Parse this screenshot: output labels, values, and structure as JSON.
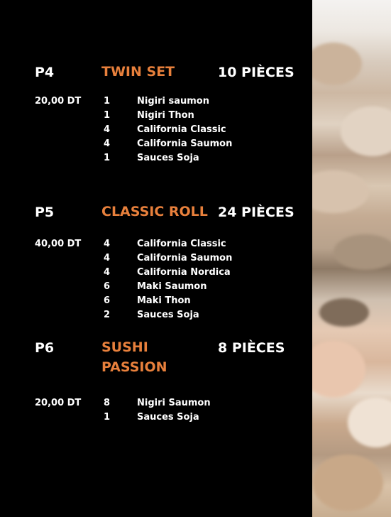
{
  "menu": {
    "sections": [
      {
        "code": "P4",
        "name_lines": [
          "TWIN SET"
        ],
        "pieces": "10 PIÈCES",
        "price": "20,00 DT",
        "items": [
          {
            "qty": "1",
            "name": "Nigiri saumon"
          },
          {
            "qty": "1",
            "name": "Nigiri Thon"
          },
          {
            "qty": "4",
            "name": "California Classic"
          },
          {
            "qty": "4",
            "name": "California Saumon"
          },
          {
            "qty": "1",
            "name": "Sauces Soja"
          }
        ]
      },
      {
        "code": "P5",
        "name_lines": [
          "CLASSIC ROLL"
        ],
        "pieces": "24 PIÈCES",
        "price": "40,00 DT",
        "items": [
          {
            "qty": "4",
            "name": "California Classic"
          },
          {
            "qty": "4",
            "name": "California Saumon"
          },
          {
            "qty": "4",
            "name": "California Nordica"
          },
          {
            "qty": "6",
            "name": "Maki Saumon"
          },
          {
            "qty": "6",
            "name": "Maki Thon"
          },
          {
            "qty": "2",
            "name": "Sauces Soja"
          }
        ]
      },
      {
        "code": "P6",
        "name_lines": [
          "SUSHI",
          "PASSION"
        ],
        "pieces": "8 PIÈCES",
        "price": "20,00 DT",
        "items": [
          {
            "qty": "8",
            "name": "Nigiri Saumon"
          },
          {
            "qty": "1",
            "name": "Sauces Soja"
          }
        ]
      }
    ]
  },
  "colors": {
    "background": "#000000",
    "accent": "#e8803c",
    "text": "#ffffff"
  }
}
